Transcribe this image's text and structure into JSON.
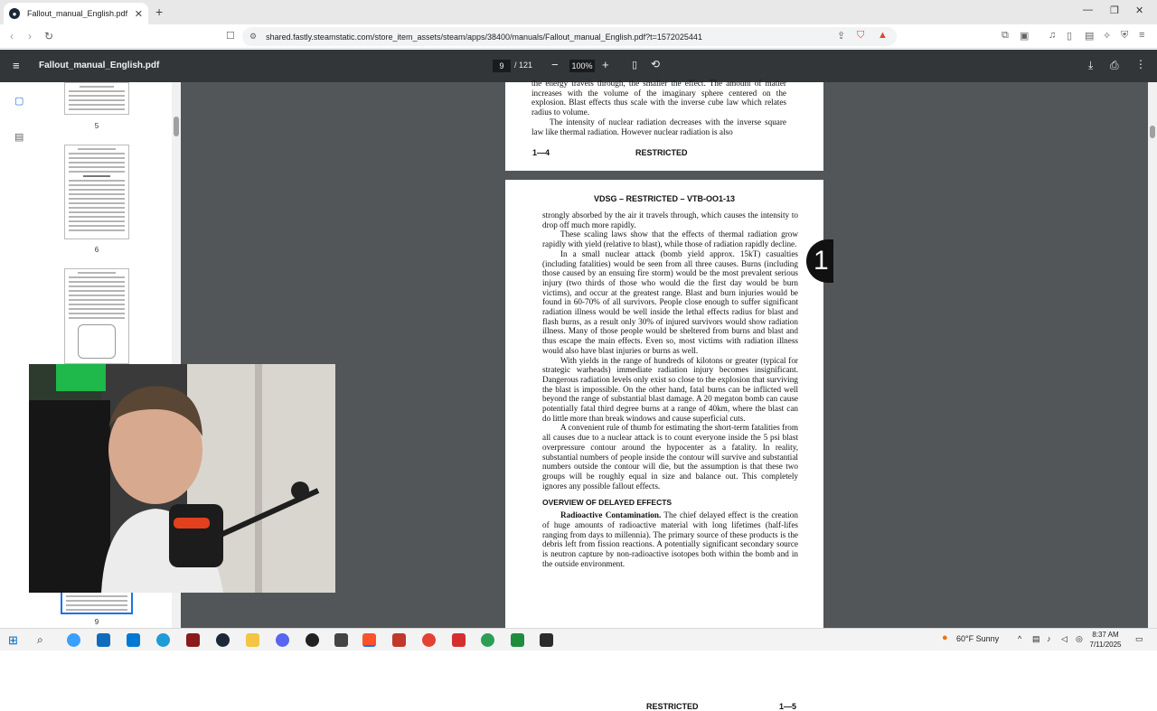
{
  "browser": {
    "tab_title": "Fallout_manual_English.pdf",
    "tab_close": "✕",
    "new_tab": "+",
    "url": "shared.fastly.steamstatic.com/store_item_assets/steam/apps/38400/manuals/Fallout_manual_English.pdf?t=1572025441",
    "window_controls": [
      "—",
      "❐",
      "✕"
    ]
  },
  "pdf_toolbar": {
    "filename": "Fallout_manual_English.pdf",
    "current_page": "9",
    "total_pages": "/ 121",
    "zoom": "100%"
  },
  "thumbnails": [
    {
      "number": "5"
    },
    {
      "number": "6"
    },
    {
      "number": ""
    },
    {
      "number": "9"
    }
  ],
  "page_prev": {
    "lines": [
      "the energy travels through, the smaller the effect. The amount of matter increases with the volume of the imaginary sphere centered on the explosion. Blast effects thus scale with the inverse cube law which relates radius to volume.",
      "The intensity of nuclear radiation decreases with the inverse square law like thermal radiation. However nuclear radiation is also"
    ],
    "footer_left": "1—4",
    "footer_center": "RESTRICTED"
  },
  "page_current": {
    "header": "VDSG – RESTRICTED – VTB-OO1-13",
    "side_tab": "1",
    "para1": "strongly absorbed by the air it travels through, which causes the intensity to drop off much more rapidly.",
    "para2": "These scaling laws show that the effects of thermal radiation grow rapidly with yield (relative to blast), while those of radiation rapidly decline.",
    "para3": "In a small nuclear attack (bomb yield approx. 15kT) casualties (including fatalities) would be seen from all three causes. Burns (including those caused by an ensuing fire storm) would be the most prevalent serious injury (two thirds of those who would die the first day would be burn victims), and occur at the greatest range. Blast and burn injuries would be found in 60-70% of all survivors. People close enough to suffer significant radiation illness would be well inside the lethal effects radius for blast and flash burns, as a result only 30% of injured survivors would show radiation illness. Many of those people would be sheltered from burns and blast and thus escape the main effects. Even so, most victims with radiation illness would also have blast injuries or burns as well.",
    "para4": "With yields in the range of hundreds of kilotons or greater (typical for strategic warheads) immediate radiation injury becomes insignificant. Dangerous radiation levels only exist so close to the explosion that surviving the blast is impossible. On the other hand, fatal burns can be inflicted well beyond the range of substantial blast damage. A 20 megaton bomb can cause potentially fatal third degree burns at a range of 40km, where the blast can do little more than break windows and cause superficial cuts.",
    "para5": "A convenient rule of thumb for estimating the short-term fatalities from all causes due to a nuclear attack is to count everyone inside the 5 psi blast overpressure contour around the hypocenter as a fatality. In reality, substantial numbers of people inside the contour will survive and substantial numbers outside the contour will die, but the assumption is that these two groups will be roughly equal in size and balance out. This completely ignores any possible fallout effects.",
    "section_heading": "OVERVIEW OF DELAYED EFFECTS",
    "sub_heading": "Radioactive Contamination.",
    "para6": "The chief delayed effect is the creation of huge amounts of radioactive material with long lifetimes (half-lifes ranging from days to millennia). The primary source of these products is the debris left from fission reactions. A potentially significant secondary source is neutron capture by non-radioactive isotopes both within the bomb and in the outside environment.",
    "footer_center": "RESTRICTED",
    "footer_right": "1—5"
  },
  "taskbar": {
    "weather": "60°F  Sunny",
    "time": "8:37 AM",
    "date": "7/11/2025"
  },
  "colors": {
    "pdf_bar": "#323639",
    "viewer_bg": "#525659",
    "taskbar": "#f3f3f3"
  }
}
